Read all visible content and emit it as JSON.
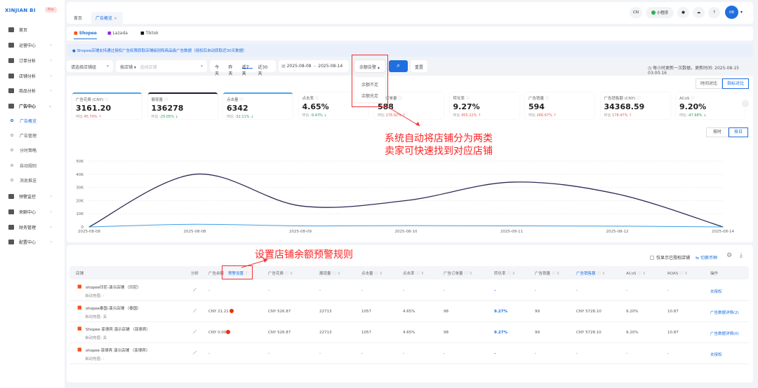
{
  "sidebar": {
    "logo": "XINJIAN BI",
    "badge": "Pro",
    "items": [
      {
        "label": "首页",
        "icon": "home-icon"
      },
      {
        "label": "运营中心",
        "icon": "monitor-icon"
      },
      {
        "label": "订单分析",
        "icon": "bar-chart-icon"
      },
      {
        "label": "店铺分析",
        "icon": "store-icon"
      },
      {
        "label": "商品分析",
        "icon": "product-icon"
      },
      {
        "label": "广告中心",
        "icon": "ad-icon"
      }
    ],
    "sub_items": [
      "广告概览",
      "广告管理",
      "分时策略",
      "自动规则",
      "消息推送"
    ],
    "items2": [
      {
        "label": "预警监控",
        "icon": "alert-icon"
      },
      {
        "label": "来聊中心",
        "icon": "chat-icon"
      },
      {
        "label": "财务管理",
        "icon": "finance-icon"
      },
      {
        "label": "配置中心",
        "icon": "settings-icon"
      }
    ]
  },
  "header": {
    "lang": "CN",
    "mini_program": "小程序",
    "avatar": "08",
    "tabs": [
      "首页",
      "广告概览"
    ]
  },
  "platforms": [
    "Shopee",
    "Lazada",
    "Tiktok"
  ],
  "notice": "Shopee店铺支持通过授权广告权限获取店铺级别和商品级广告数据（授权后自动获取近30天数据）",
  "filters": {
    "shop_group_placeholder": "请选择店铺组",
    "by_shop": "按店铺",
    "shop_placeholder": "选择店铺",
    "ranges": [
      "今天",
      "昨天",
      "近7天",
      "近30天"
    ],
    "active_range": "近7天",
    "date_start": "2025-08-08",
    "date_end": "2025-08-14",
    "balance_alert": "余额告警",
    "balance_options": [
      "余额不足",
      "余额充足"
    ],
    "reset": "重置",
    "update_info": "每小时更新一次数据，更新时间:",
    "update_time": "2025-08-15 03:00:16"
  },
  "compare": {
    "time": "时间对比",
    "metric": "指标对比",
    "hourly": "按时",
    "daily": "按日"
  },
  "kpis": [
    {
      "title": "广告花费 (CNY)",
      "value": "3161.20",
      "change": "45.70%",
      "dir": "up"
    },
    {
      "title": "展现量",
      "value": "136278",
      "change": "-25.05%",
      "dir": "down"
    },
    {
      "title": "点击量",
      "value": "6342",
      "change": "-32.11%",
      "dir": "down"
    },
    {
      "title": "点击率",
      "value": "4.65%",
      "change": "-9.43%",
      "dir": "down"
    },
    {
      "title": "广告订单量",
      "value": "588",
      "change": "276.92%",
      "dir": "up"
    },
    {
      "title": "转化率",
      "value": "9.27%",
      "change": "455.22%",
      "dir": "up"
    },
    {
      "title": "广告销量",
      "value": "594",
      "change": "266.67%",
      "dir": "up"
    },
    {
      "title": "广告销售额 (CNY)",
      "value": "34368.59",
      "change": "178.47%",
      "dir": "up"
    },
    {
      "title": "ACoS",
      "value": "9.20%",
      "change": "-47.68%",
      "dir": "down"
    }
  ],
  "kpi_change_label": "环比",
  "annotations": {
    "a1_line1": "系统自动将店铺分为两类",
    "a1_line2": "卖家可快速找到对应店铺",
    "a2": "设置店铺余额预警规则"
  },
  "chart_data": {
    "type": "line",
    "x": [
      "2025-08-08",
      "2025-08-08",
      "2025-08-09",
      "2025-08-10",
      "2025-08-11",
      "2025-08-12",
      "2025-08-14"
    ],
    "yticks": [
      "0",
      "10K",
      "20K",
      "30K",
      "40K",
      "50K"
    ],
    "ylim": [
      0,
      50000
    ],
    "grid": true,
    "series": [
      {
        "color": "#2d2a55",
        "values": [
          0,
          40000,
          16000,
          20000,
          34000,
          25000,
          0
        ]
      },
      {
        "color": "#3fa0e6",
        "values": [
          0,
          2000,
          800,
          1000,
          800,
          600,
          0
        ]
      }
    ]
  },
  "table": {
    "only_authorized": "仅显示已授权店铺",
    "switch_currency": "切换币种",
    "headers": [
      "店铺",
      "分析",
      "广告余额",
      "预警设置",
      "广告花费",
      "展现量",
      "点击量",
      "点击率",
      "广告订单量",
      "转化率",
      "广告销量",
      "广告销售额",
      "ACoS",
      "ROAS",
      "操作"
    ],
    "rows": [
      {
        "shop": "shopee印尼-演示店铺 （印尼）",
        "recharge": "自动充值: -",
        "balance": "-",
        "alert": false,
        "spend": "-",
        "impr": "-",
        "clicks": "-",
        "ctr": "-",
        "orders": "-",
        "cvr": "-",
        "sales": "-",
        "revenue": "-",
        "acos": "-",
        "roas": "-",
        "action": "去授权"
      },
      {
        "shop": "shopee泰国-演示店铺 （泰国）",
        "recharge": "自动充值: 关",
        "balance": "CNY 21.21",
        "alert": true,
        "spend": "CNY 526.87",
        "impr": "22713",
        "clicks": "1057",
        "ctr": "4.65%",
        "orders": "98",
        "cvr": "9.27%",
        "sales": "99",
        "revenue": "CNY 5728.10",
        "acos": "9.20%",
        "roas": "10.87",
        "action": "广告数据详情(2)"
      },
      {
        "shop": "Shopee 菲律宾 演示店铺 （菲律宾）",
        "recharge": "自动充值: 关",
        "balance": "CNY 0.00",
        "alert": true,
        "spend": "CNY 526.87",
        "impr": "22713",
        "clicks": "1057",
        "ctr": "4.65%",
        "orders": "98",
        "cvr": "9.27%",
        "sales": "99",
        "revenue": "CNY 5728.10",
        "acos": "9.20%",
        "roas": "10.87",
        "action": "广告数据详情(0)"
      },
      {
        "shop": "shopee 菲律宾 演示店铺 （菲律宾）",
        "recharge": "自动充值: -",
        "balance": "-",
        "alert": false,
        "spend": "-",
        "impr": "-",
        "clicks": "-",
        "ctr": "-",
        "orders": "-",
        "cvr": "-",
        "sales": "-",
        "revenue": "-",
        "acos": "-",
        "roas": "-",
        "action": "去授权"
      }
    ]
  }
}
